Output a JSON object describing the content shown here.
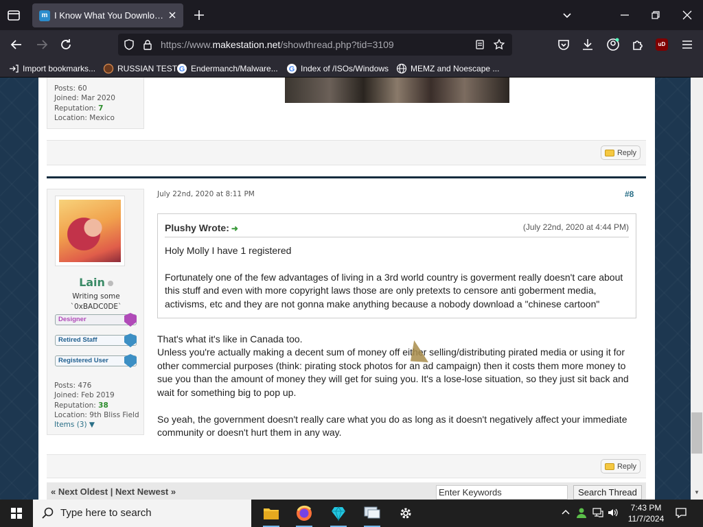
{
  "browser": {
    "tab_title": "I Know What You Download...",
    "tab_favicon": "m",
    "url_prefix": "https://www.",
    "url_domain": "makestation.net",
    "url_path": "/showthread.php?tid=3109",
    "bookmarks": [
      "Import bookmarks...",
      "RUSSIAN TEST",
      "Endermanch/Malware...",
      "Index of /ISOs/Windows",
      "MEMZ and Noescape ..."
    ],
    "ublock_label": "uD"
  },
  "post1": {
    "posts": "Posts: 60",
    "joined": "Joined: Mar 2020",
    "reputation_label": "Reputation: ",
    "reputation_value": "7",
    "location": "Location: Mexico",
    "reply_label": "Reply"
  },
  "post2": {
    "username": "Lain",
    "usertitle_1": "Writing some",
    "usertitle_2": "`0xBADC0DE`",
    "userbars": [
      "Designer",
      "Retired Staff",
      "Registered User"
    ],
    "posts": "Posts: 476",
    "joined": "Joined: Feb 2019",
    "reputation_label": "Reputation: ",
    "reputation_value": "38",
    "location": "Location: 9th Bliss Field",
    "items": "Items (3) ▼",
    "date": "July 22nd, 2020 at 8:11 PM",
    "post_number": "#8",
    "quote": {
      "author": "Plushy Wrote:",
      "date": "(July 22nd, 2020 at 4:44 PM)",
      "lines": [
        "Holy Molly I have 1 registered",
        "Fortunately one of the few advantages of living in a 3rd world country is goverment really doesn't care about",
        "this stuff and even with more copyright laws those are only pretexts to censore anti goberment media,",
        "activisms, etc and they are not gonna make anything because a nobody download a \"chinese cartoon\""
      ]
    },
    "body_lines": [
      "That's what it's like in Canada too.",
      "Unless you're actually making a decent sum of money off either selling/distributing pirated media or using it for",
      "other commercial purposes (think: pirating stock photos for an ad campaign) then it costs them more money to",
      "sue you than the amount of money they will get for suing you. It's a lose-lose situation, so they just sit back and",
      "wait for something big to pop up.",
      "So yeah, the government doesn't really care what you do as long as it doesn't negatively affect your immediate",
      "community or doesn't hurt them in any way."
    ],
    "reply_label": "Reply"
  },
  "thread_nav": {
    "text": "« Next Oldest | Next Newest »",
    "search_placeholder": "Enter Keywords",
    "search_button": "Search Thread"
  },
  "taskbar": {
    "search_placeholder": "Type here to search",
    "time": "7:43 PM",
    "date": "11/7/2024"
  },
  "colors": {
    "accent_green": "#2c8c2c",
    "link_teal": "#2a6f87",
    "page_bg": "#1d3750"
  }
}
